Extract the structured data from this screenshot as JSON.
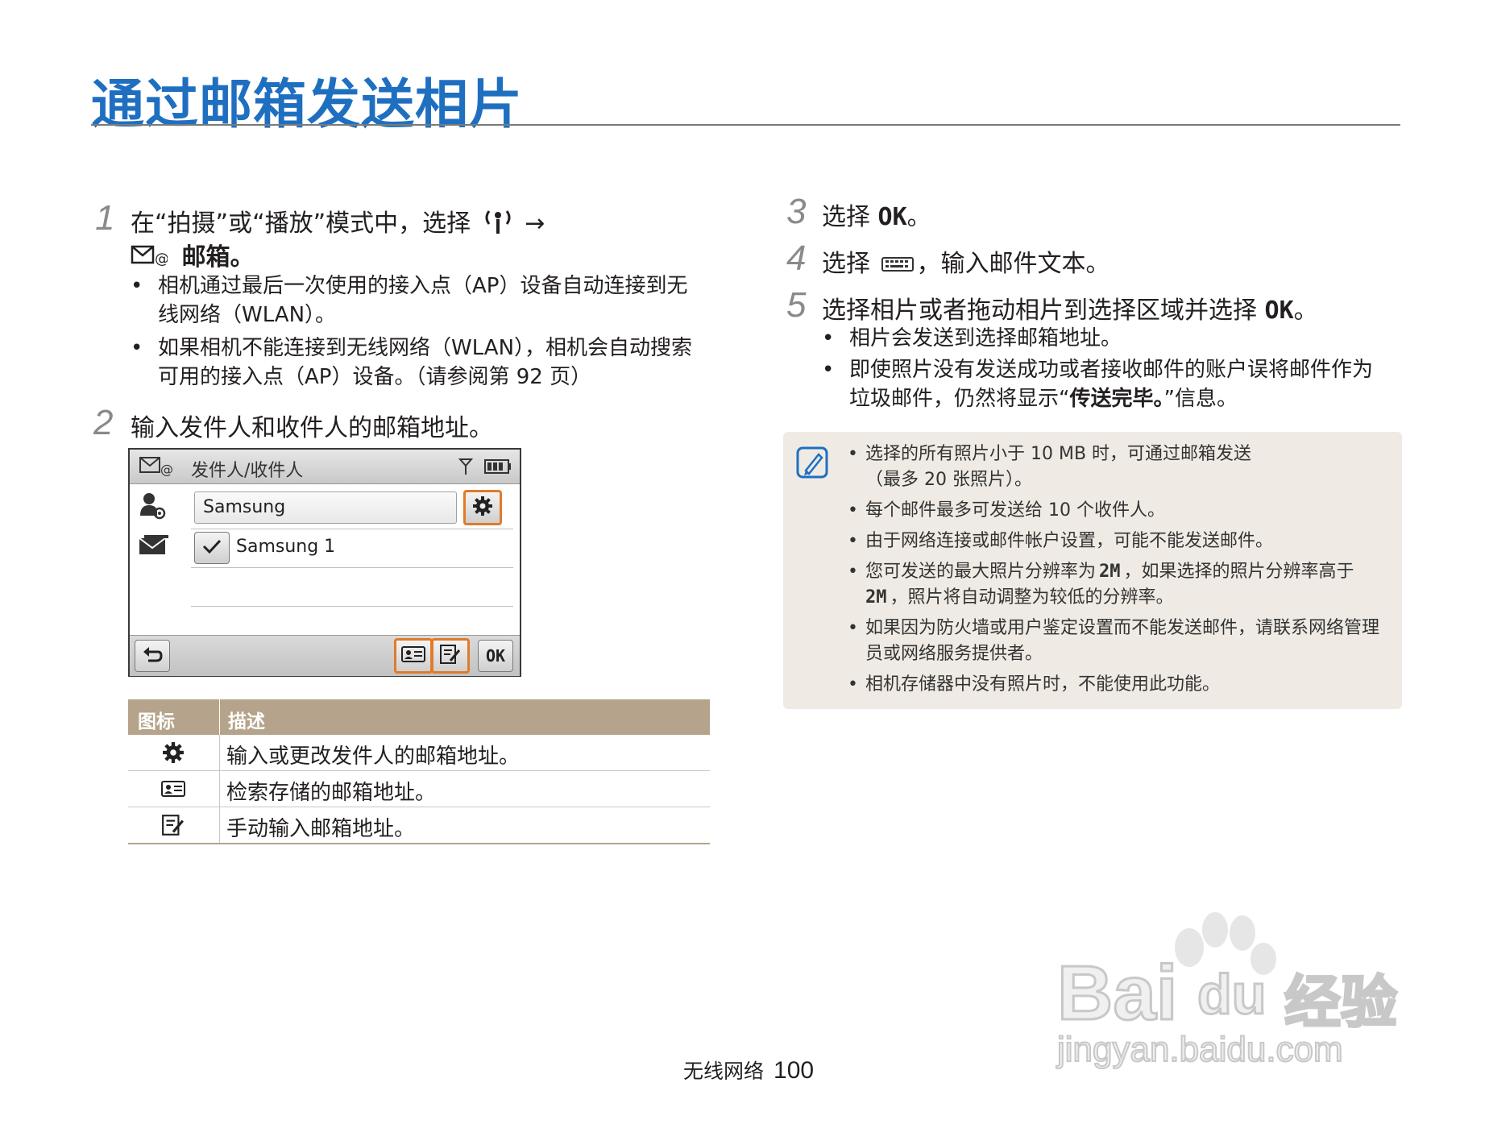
{
  "title": "通过邮箱发送相片",
  "steps_left": {
    "s1_num": "1",
    "s1_line1_a": "在“拍摄”或“播放”模式中，选择",
    "s1_line1_b": "→",
    "s1_line2": "邮箱。",
    "s1_b1_l1": "相机通过最后一次使用的接入点（AP）设备自动连接到无",
    "s1_b1_l2": "线网络（WLAN）。",
    "s1_b2_l1": "如果相机不能连接到无线网络（WLAN），相机会自动搜索",
    "s1_b2_l2": "可用的接入点（AP）设备。（请参阅第 92 页）",
    "s2_num": "2",
    "s2_text": "输入发件人和收件人的邮箱地址。"
  },
  "camera_screen": {
    "header": "发件人/收件人",
    "sender": "Samsung",
    "recipient": "Samsung 1",
    "ok_label": "OK"
  },
  "icon_table": {
    "col_icon": "图标",
    "col_desc": "描述",
    "rows": [
      {
        "icon": "gear-icon",
        "desc": "输入或更改发件人的邮箱地址。"
      },
      {
        "icon": "contact-card-icon",
        "desc": "检索存储的邮箱地址。"
      },
      {
        "icon": "edit-note-icon",
        "desc": "手动输入邮箱地址。"
      }
    ]
  },
  "steps_right": {
    "s3_num": "3",
    "s3_a": "选择",
    "s3_ok": "OK",
    "s3_b": "。",
    "s4_num": "4",
    "s4_a": "选择",
    "s4_b": "，输入邮件文本。",
    "s5_num": "5",
    "s5_a": "选择相片或者拖动相片到选择区域并选择",
    "s5_ok": "OK",
    "s5_b": "。",
    "s5_b1": "相片会发送到选择邮箱地址。",
    "s5_b2_l1": "即使照片没有发送成功或者接收邮件的账户误将邮件作为",
    "s5_b2_l2a": "垃圾邮件，仍然将显示“",
    "s5_b2_l2b": "传送完毕。",
    "s5_b2_l2c": "”信息。"
  },
  "notes": {
    "n1_l1": "选择的所有照片小于 10 MB 时，可通过邮箱发送",
    "n1_l2": "（最多 20 张照片）。",
    "n2": "每个邮件最多可发送给 10 个收件人。",
    "n3": "由于网络连接或邮件帐户设置，可能不能发送邮件。",
    "n4_l1a": "您可发送的最大照片分辨率为",
    "n4_res": "2M",
    "n4_l1b": "，如果选择的照片分辨率高于",
    "n4_l2": "，照片将自动调整为较低的分辨率。",
    "n5_l1": "如果因为防火墙或用户鉴定设置而不能发送邮件，请联系网络管理",
    "n5_l2": "员或网络服务提供者。",
    "n6": "相机存储器中没有照片时，不能使用此功能。"
  },
  "footer": {
    "section": "无线网络",
    "page": "100"
  },
  "watermark": {
    "brand": "Bai",
    "brand2": "du",
    "cn": "经验",
    "url": "jingyan.baidu.com"
  },
  "colors": {
    "title_blue": "#1f6fc1",
    "table_header": "#b5a48b",
    "note_bg": "#efebe4",
    "highlight_orange": "#e07b2a"
  }
}
